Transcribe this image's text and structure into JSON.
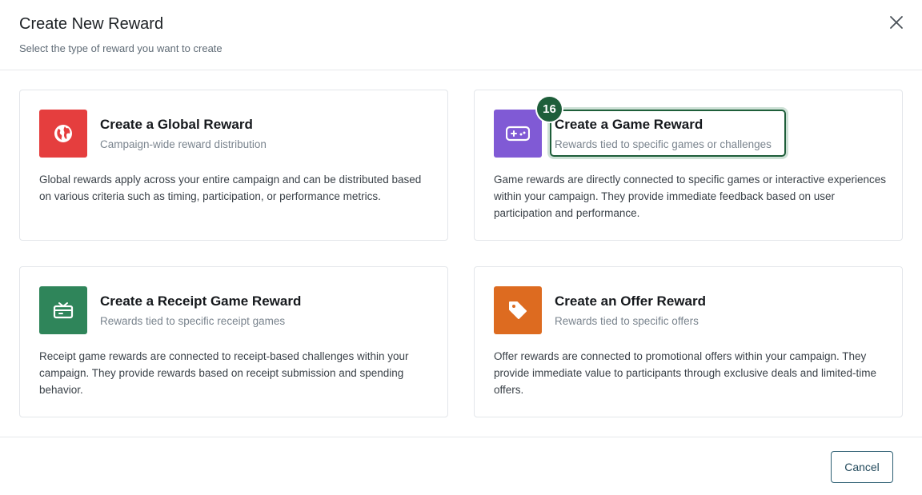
{
  "modal": {
    "title": "Create New Reward",
    "subtitle": "Select the type of reward you want to create",
    "close_icon": "close-icon"
  },
  "cards": [
    {
      "title": "Create a Global Reward",
      "subtitle": "Campaign-wide reward distribution",
      "description": "Global rewards apply across your entire campaign and can be distributed based on various criteria such as timing, participation, or performance metrics.",
      "icon": "globe-icon",
      "icon_color": "#e53e3e"
    },
    {
      "title": "Create a Game Reward",
      "subtitle": "Rewards tied to specific games or challenges",
      "description": "Game rewards are directly connected to specific games or interactive experiences within your campaign. They provide immediate feedback based on user participation and performance.",
      "icon": "gamepad-icon",
      "icon_color": "#805ad5",
      "step_badge": "16"
    },
    {
      "title": "Create a Receipt Game Reward",
      "subtitle": "Rewards tied to specific receipt games",
      "description": "Receipt game rewards are connected to receipt-based challenges within your campaign. They provide rewards based on receipt submission and spending behavior.",
      "icon": "ticket-icon",
      "icon_color": "#2f855a"
    },
    {
      "title": "Create an Offer Reward",
      "subtitle": "Rewards tied to specific offers",
      "description": "Offer rewards are connected to promotional offers within your campaign. They provide immediate value to participants through exclusive deals and limited-time offers.",
      "icon": "tag-icon",
      "icon_color": "#dd6b20"
    }
  ],
  "footer": {
    "cancel_label": "Cancel"
  },
  "colors": {
    "highlight": "#1e5e3a",
    "cancel_border": "#2d5f73"
  }
}
